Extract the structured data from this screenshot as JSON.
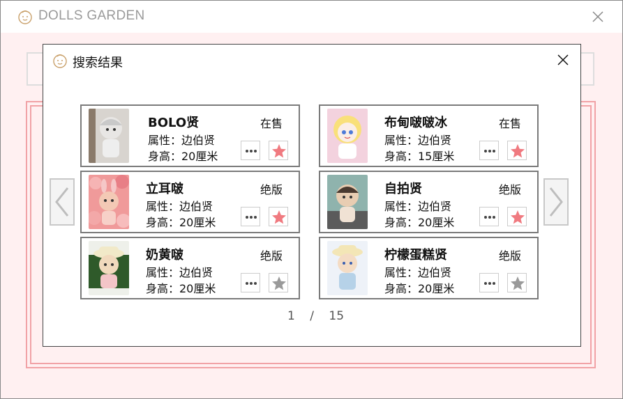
{
  "app": {
    "title": "DOLLS GARDEN",
    "logo_icon": "baby-face-icon",
    "close_icon": "close-icon"
  },
  "dialog": {
    "title": "搜索结果",
    "close_icon": "close-icon"
  },
  "colors": {
    "background": "#fff0f1",
    "frame_border": "#f1a2a6",
    "star_favorite": "#f07a80",
    "star_default": "#9a9a9a"
  },
  "results": [
    {
      "name": "BOLO贤",
      "status": "在售",
      "attr": "属性：边伯贤",
      "height": "身高：20厘米",
      "favorited": true
    },
    {
      "name": "布甸啵啵冰",
      "status": "在售",
      "attr": "属性：边伯贤",
      "height": "身高：15厘米",
      "favorited": true
    },
    {
      "name": "立耳啵",
      "status": "绝版",
      "attr": "属性：边伯贤",
      "height": "身高：20厘米",
      "favorited": true
    },
    {
      "name": "自拍贤",
      "status": "绝版",
      "attr": "属性：边伯贤",
      "height": "身高：20厘米",
      "favorited": true
    },
    {
      "name": "奶黄啵",
      "status": "绝版",
      "attr": "属性：边伯贤",
      "height": "身高：20厘米",
      "favorited": false
    },
    {
      "name": "柠檬蛋糕贤",
      "status": "绝版",
      "attr": "属性：边伯贤",
      "height": "身高：20厘米",
      "favorited": false
    }
  ],
  "pagination": {
    "current": "1",
    "separator": "/",
    "total": "15"
  }
}
